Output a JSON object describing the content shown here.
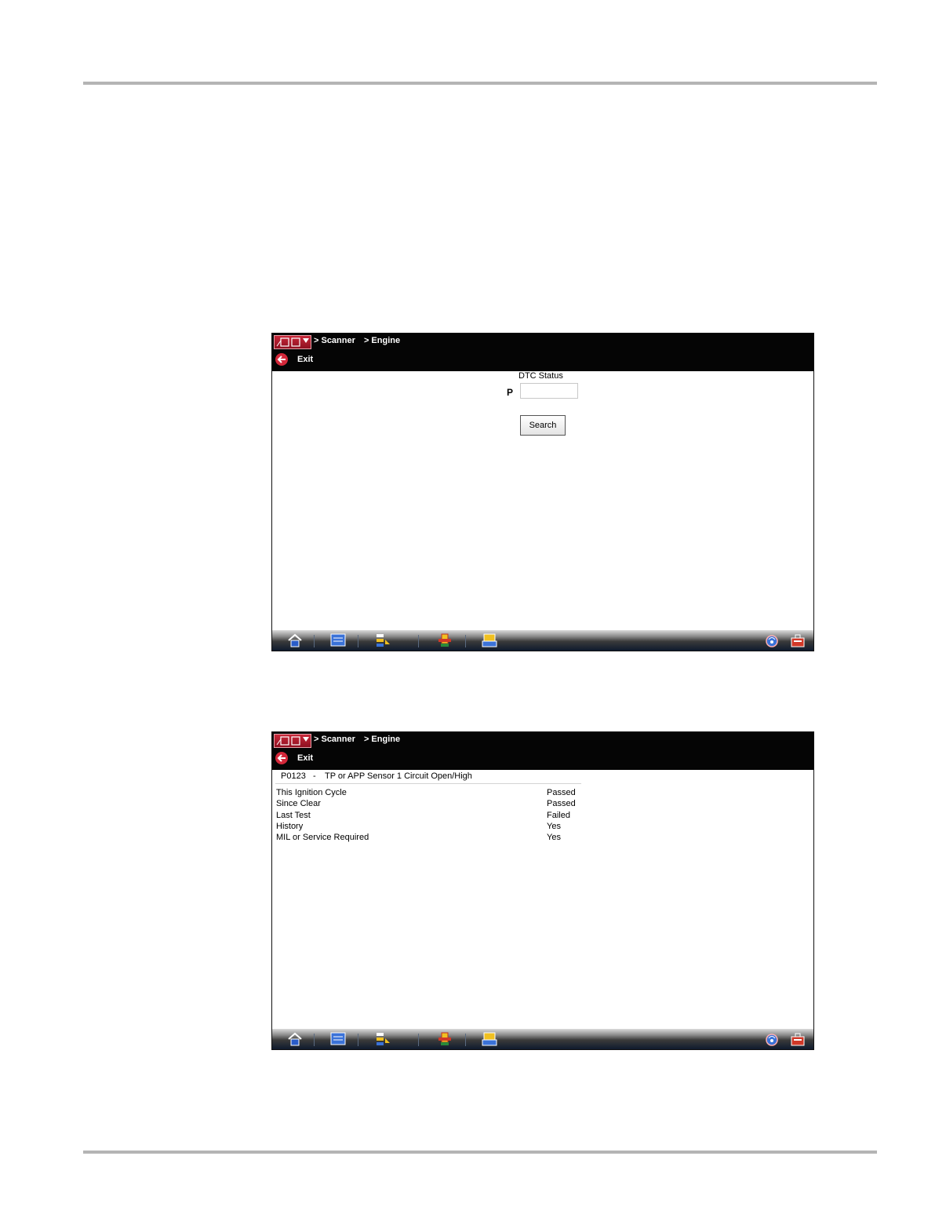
{
  "breadcrumb": [
    "> Scanner",
    "> Engine"
  ],
  "exit_label": "Exit",
  "screen1": {
    "dtc_status_label": "DTC Status",
    "code_prefix": "P",
    "code_value": "",
    "search_label": "Search"
  },
  "screen2": {
    "code": "P0123",
    "dash": "-",
    "description": "TP or APP Sensor 1 Circuit Open/High",
    "rows": [
      {
        "label": "This Ignition Cycle",
        "value": "Passed"
      },
      {
        "label": "Since Clear",
        "value": "Passed"
      },
      {
        "label": "Last Test",
        "value": "Failed"
      },
      {
        "label": "History",
        "value": "Yes"
      },
      {
        "label": "MIL or Service Required",
        "value": "Yes"
      }
    ]
  },
  "taskbar_icons": [
    "home-icon",
    "vehicle-id-icon",
    "data-menu-icon",
    "scanner-icon",
    "print-icon",
    "wireless-icon",
    "toolbox-icon"
  ],
  "colors": {
    "title_bar": "#050505",
    "exit_red": "#d4283a",
    "logo_red": "#c8283a",
    "rule_gray": "#b4b4b4"
  }
}
